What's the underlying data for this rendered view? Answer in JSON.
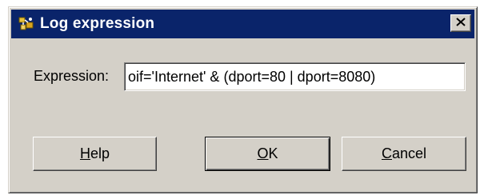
{
  "dialog": {
    "title": "Log expression",
    "icon": "network-object-icon",
    "close_icon": "close-icon"
  },
  "expression": {
    "label": "Expression:",
    "value": "oif='Internet' & (dport=80 | dport=8080)"
  },
  "buttons": {
    "help": {
      "mnemonic": "H",
      "rest": "elp"
    },
    "ok": {
      "mnemonic": "O",
      "rest": "K"
    },
    "cancel": {
      "mnemonic": "C",
      "rest": "ancel"
    }
  },
  "colors": {
    "titlebar": "#0a246a",
    "face": "#d4d0c8"
  }
}
